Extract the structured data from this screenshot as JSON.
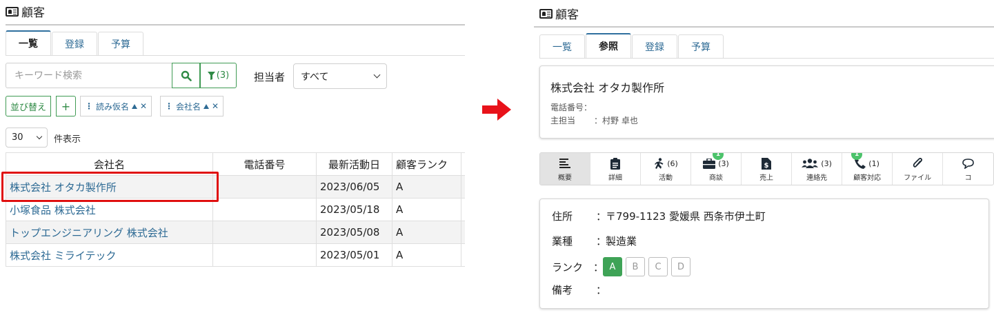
{
  "left": {
    "title": "顧客",
    "tabs": [
      "一覧",
      "登録",
      "予算"
    ],
    "search": {
      "placeholder": "キーワード検索",
      "filter_count": "(3)"
    },
    "owner": {
      "label": "担当者",
      "value": "すべて"
    },
    "sort": {
      "label": "並び替え",
      "add": "+",
      "chips": [
        "読み仮名",
        "会社名"
      ]
    },
    "page_size": {
      "value": "30",
      "suffix": "件表示"
    },
    "table": {
      "headers": [
        "会社名",
        "電話番号",
        "最新活動日",
        "顧客ランク"
      ],
      "rows": [
        {
          "company": "株式会社 オタカ製作所",
          "phone": "",
          "date": "2023/06/05",
          "rank": "A"
        },
        {
          "company": "小塚食品 株式会社",
          "phone": "",
          "date": "2023/05/18",
          "rank": "A"
        },
        {
          "company": "トップエンジニアリング 株式会社",
          "phone": "",
          "date": "2023/05/08",
          "rank": "A"
        },
        {
          "company": "株式会社 ミライテック",
          "phone": "",
          "date": "2023/05/01",
          "rank": "A"
        }
      ]
    }
  },
  "right": {
    "title": "顧客",
    "tabs": [
      "一覧",
      "参照",
      "登録",
      "予算"
    ],
    "company": {
      "name": "株式会社 オタカ製作所",
      "phone_label": "電話番号：",
      "owner_label": "主担当",
      "owner_value": "：村野 卓也"
    },
    "iconbar": [
      {
        "label": "概要",
        "icon": "list-icon"
      },
      {
        "label": "詳細",
        "icon": "clipboard-icon"
      },
      {
        "label": "活動",
        "icon": "running-icon",
        "count": "(6)"
      },
      {
        "label": "商談",
        "icon": "briefcase-icon",
        "count": "(3)",
        "badge": "1"
      },
      {
        "label": "売上",
        "icon": "invoice-icon"
      },
      {
        "label": "連絡先",
        "icon": "users-icon",
        "count": "(3)"
      },
      {
        "label": "顧客対応",
        "icon": "phone-icon",
        "count": "(1)",
        "badge": "1"
      },
      {
        "label": "ファイル",
        "icon": "paperclip-icon"
      },
      {
        "label": "コ",
        "icon": "comment-icon"
      }
    ],
    "details": {
      "address_label": "住所",
      "address_value": "〒799-1123 愛媛県 西条市伊土町",
      "industry_label": "業種",
      "industry_value": "製造業",
      "rank_label": "ランク",
      "ranks": [
        "A",
        "B",
        "C",
        "D"
      ],
      "selected_rank": "A",
      "notes_label": "備考",
      "notes_value": "",
      "colon": "："
    }
  },
  "colors": {
    "accent_blue": "#2d6a94",
    "green": "#3ea356",
    "arrow_red": "#e8121a",
    "highlight_red": "#e01010"
  }
}
